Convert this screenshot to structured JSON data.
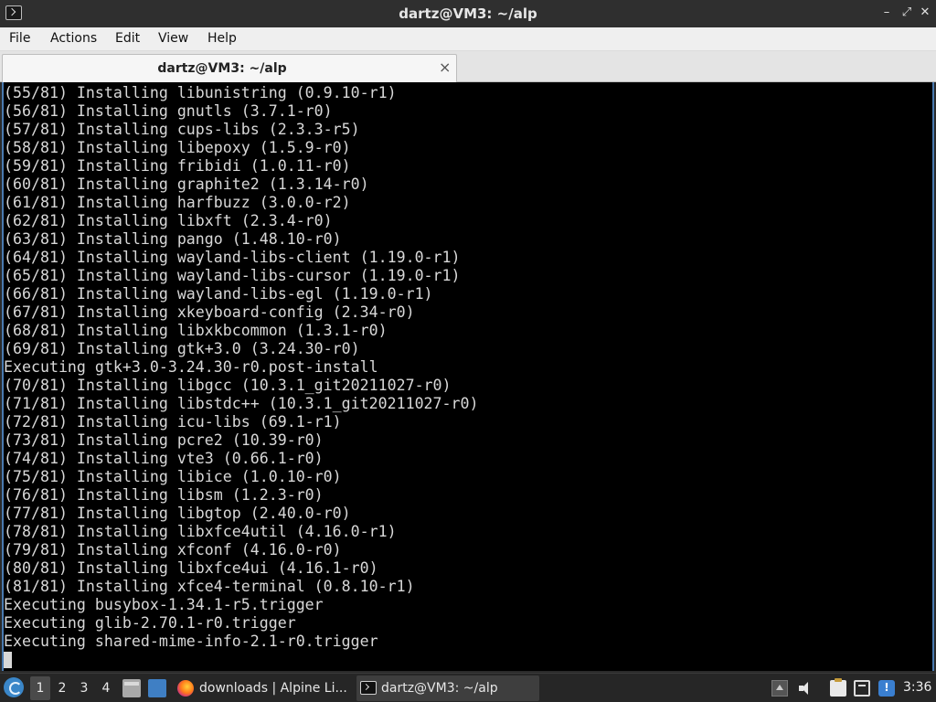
{
  "window": {
    "title": "dartz@VM3: ~/alp",
    "app_icon": "terminal-icon",
    "controls": {
      "minimize": "–",
      "maximize": "⤢",
      "close": "✕"
    }
  },
  "menubar": {
    "items": [
      "File",
      "Actions",
      "Edit",
      "View",
      "Help"
    ]
  },
  "tab": {
    "label": "dartz@VM3: ~/alp",
    "close": "×"
  },
  "terminal": {
    "lines": [
      "(55/81) Installing libunistring (0.9.10-r1)",
      "(56/81) Installing gnutls (3.7.1-r0)",
      "(57/81) Installing cups-libs (2.3.3-r5)",
      "(58/81) Installing libepoxy (1.5.9-r0)",
      "(59/81) Installing fribidi (1.0.11-r0)",
      "(60/81) Installing graphite2 (1.3.14-r0)",
      "(61/81) Installing harfbuzz (3.0.0-r2)",
      "(62/81) Installing libxft (2.3.4-r0)",
      "(63/81) Installing pango (1.48.10-r0)",
      "(64/81) Installing wayland-libs-client (1.19.0-r1)",
      "(65/81) Installing wayland-libs-cursor (1.19.0-r1)",
      "(66/81) Installing wayland-libs-egl (1.19.0-r1)",
      "(67/81) Installing xkeyboard-config (2.34-r0)",
      "(68/81) Installing libxkbcommon (1.3.1-r0)",
      "(69/81) Installing gtk+3.0 (3.24.30-r0)",
      "Executing gtk+3.0-3.24.30-r0.post-install",
      "(70/81) Installing libgcc (10.3.1_git20211027-r0)",
      "(71/81) Installing libstdc++ (10.3.1_git20211027-r0)",
      "(72/81) Installing icu-libs (69.1-r1)",
      "(73/81) Installing pcre2 (10.39-r0)",
      "(74/81) Installing vte3 (0.66.1-r0)",
      "(75/81) Installing libice (1.0.10-r0)",
      "(76/81) Installing libsm (1.2.3-r0)",
      "(77/81) Installing libgtop (2.40.0-r0)",
      "(78/81) Installing libxfce4util (4.16.0-r1)",
      "(79/81) Installing xfconf (4.16.0-r0)",
      "(80/81) Installing libxfce4ui (4.16.1-r0)",
      "(81/81) Installing xfce4-terminal (0.8.10-r1)",
      "Executing busybox-1.34.1-r5.trigger",
      "Executing glib-2.70.1-r0.trigger",
      "Executing shared-mime-info-2.1-r0.trigger"
    ]
  },
  "taskbar": {
    "workspaces": [
      "1",
      "2",
      "3",
      "4"
    ],
    "active_workspace": "1",
    "tasks": [
      {
        "label": "downloads | Alpine Li...",
        "icon": "firefox-icon"
      },
      {
        "label": "dartz@VM3: ~/alp",
        "icon": "terminal-icon"
      }
    ],
    "clock": "3:36"
  }
}
